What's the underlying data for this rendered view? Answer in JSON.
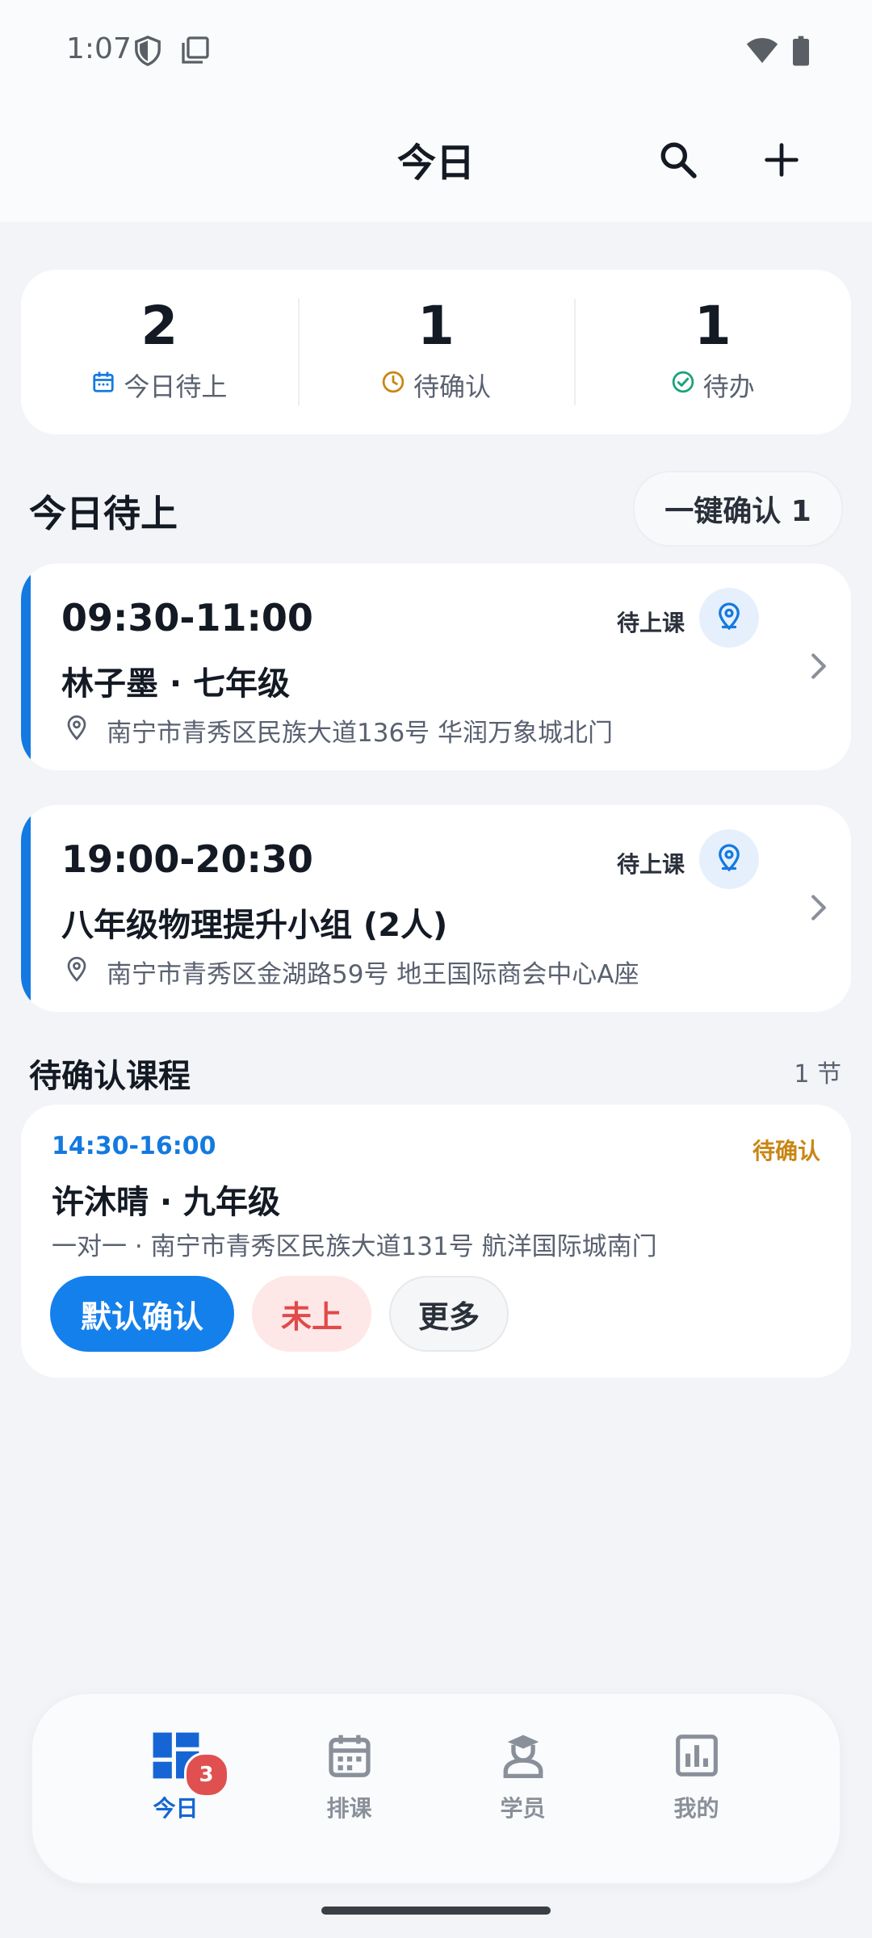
{
  "status_bar": {
    "time": "1:07"
  },
  "app_bar": {
    "title": "今日"
  },
  "stats": [
    {
      "value": "2",
      "label": "今日待上",
      "icon": "calendar-icon",
      "color": "#1479e0"
    },
    {
      "value": "1",
      "label": "待确认",
      "icon": "clock-icon",
      "color": "#c98614"
    },
    {
      "value": "1",
      "label": "待办",
      "icon": "check-circle-icon",
      "color": "#1aa37a"
    }
  ],
  "today_section": {
    "title": "今日待上",
    "confirm_all_label": "一键确认 1",
    "lessons": [
      {
        "time": "09:30-11:00",
        "status": "待上课",
        "student": "林子墨 · 七年级",
        "address": "南宁市青秀区民族大道136号 华润万象城北门"
      },
      {
        "time": "19:00-20:30",
        "status": "待上课",
        "student": "八年级物理提升小组 (2人)",
        "address": "南宁市青秀区金湖路59号 地王国际商会中心A座"
      }
    ]
  },
  "pending_section": {
    "title": "待确认课程",
    "count": "1 节",
    "item": {
      "time": "14:30-16:00",
      "status": "待确认",
      "student": "许沐晴 · 九年级",
      "detail": "一对一 · 南宁市青秀区民族大道131号 航洋国际城南门",
      "actions": [
        "默认确认",
        "未上",
        "更多"
      ]
    }
  },
  "bottom_nav": {
    "items": [
      {
        "label": "今日",
        "icon": "dashboard-icon",
        "active": true,
        "badge": "3"
      },
      {
        "label": "排课",
        "icon": "calendar-icon",
        "active": false
      },
      {
        "label": "学员",
        "icon": "student-icon",
        "active": false
      },
      {
        "label": "我的",
        "icon": "chart-icon",
        "active": false
      }
    ]
  },
  "colors": {
    "accent": "#1479e0",
    "warning": "#c98614",
    "danger": "#e04a4a",
    "success": "#1aa37a"
  }
}
